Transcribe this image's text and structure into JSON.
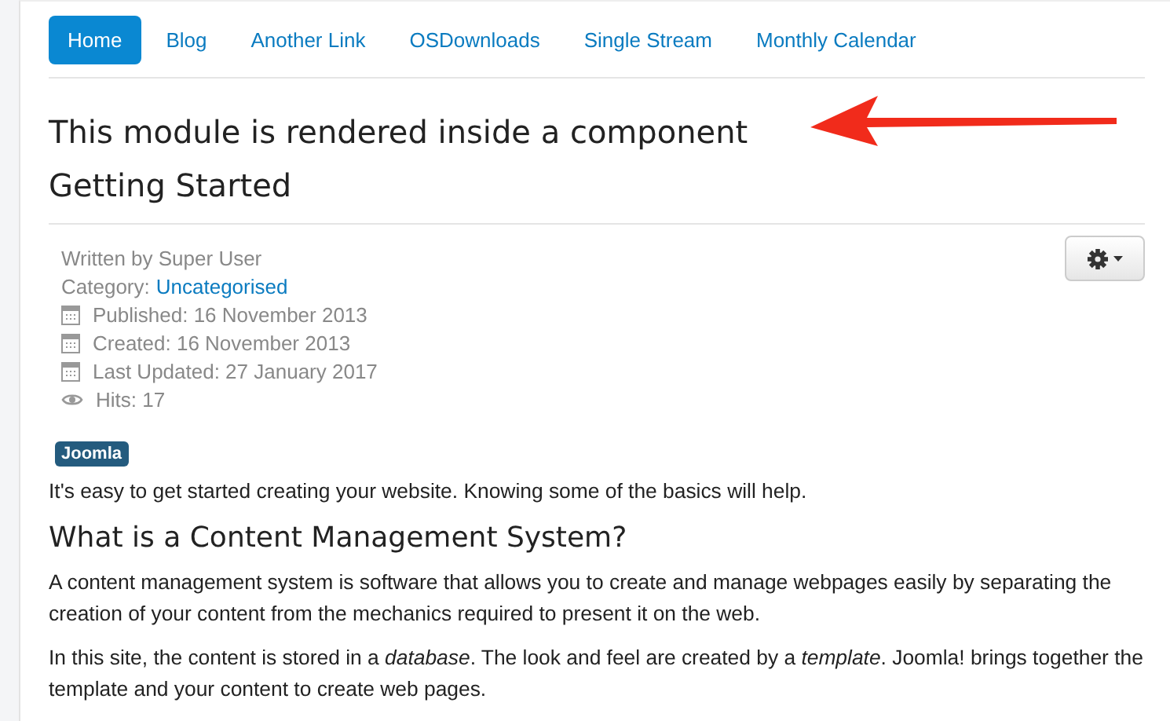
{
  "nav": [
    {
      "label": "Home",
      "selected": true
    },
    {
      "label": "Blog",
      "selected": false
    },
    {
      "label": "Another Link",
      "selected": false
    },
    {
      "label": "OSDownloads",
      "selected": false
    },
    {
      "label": "Single Stream",
      "selected": false
    },
    {
      "label": "Monthly Calendar",
      "selected": false
    }
  ],
  "module_title": "This module is rendered inside a component",
  "article": {
    "title": "Getting Started",
    "meta": [
      {
        "kind": "author",
        "text": "Written by Super User"
      },
      {
        "kind": "category",
        "text": "Category:",
        "link": "Uncategorised"
      },
      {
        "kind": "date",
        "text": "Published: 16 November 2013"
      },
      {
        "kind": "date",
        "text": "Created: 16 November 2013"
      },
      {
        "kind": "date",
        "text": "Last Updated: 27 January 2017"
      },
      {
        "kind": "hits",
        "text": "Hits: 17"
      }
    ],
    "tags": [
      "Joomla"
    ],
    "intro": "It's easy to get started creating your website. Knowing some of the basics will help.",
    "heading": "What is a Content Management System?",
    "paragraphs": [
      "A content management system is software that allows you to create and manage webpages easily by separating the creation of your content from the mechanics required to present it on the web.",
      "In this site, the content is stored in a *database*. The look and feel are created by a *template*. Joomla! brings together the template and your content to create web pages."
    ]
  }
}
